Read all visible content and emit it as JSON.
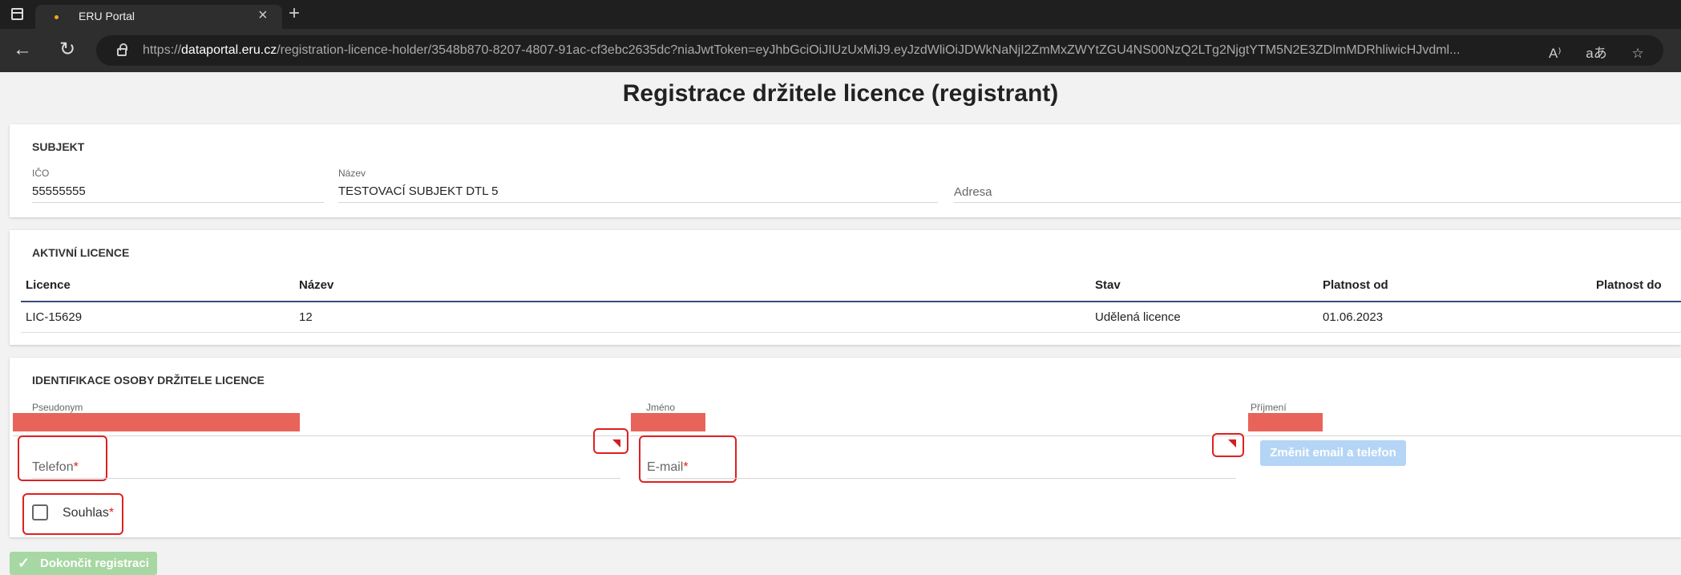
{
  "browser": {
    "tab_title": "ERU Portal",
    "tab_close": "×",
    "new_tab": "+",
    "url_scheme": "https://",
    "url_host": "dataportal.eru.cz",
    "url_path": "/registration-licence-holder/3548b870-8207-4807-91ac-cf3ebc2635dc?niaJwtToken=eyJhbGciOiJIUzUxMiJ9.eyJzdWliOiJDWkNaNjI2ZmMxZWYtZGU4NS00NzQ2LTg2NjgtYTM5N2E3ZDlmMDRhliwicHJvdml...",
    "icons": [
      "back-icon",
      "refresh-icon",
      "lock-icon",
      "read-aloud-icon",
      "translate-icon",
      "favorites-icon"
    ],
    "read_aloud_glyph": "A⁾",
    "translate_glyph": "aあ",
    "favorite_glyph": "☆"
  },
  "page": {
    "title": "Registrace držitele licence (registrant)"
  },
  "subject": {
    "heading": "SUBJEKT",
    "ico_label": "IČO",
    "ico_value": "55555555",
    "name_label": "Název",
    "name_value": "TESTOVACÍ SUBJEKT DTL 5",
    "address_label": "Adresa"
  },
  "licences": {
    "heading": "AKTIVNÍ LICENCE",
    "columns": [
      "Licence",
      "Název",
      "Stav",
      "Platnost od",
      "Platnost do"
    ],
    "rows": [
      {
        "licence": "LIC-15629",
        "name": "12",
        "status": "Udělená licence",
        "valid_from": "01.06.2023",
        "valid_to": ""
      }
    ]
  },
  "identification": {
    "heading": "IDENTIFIKACE OSOBY DRŽITELE LICENCE",
    "pseudonym_label": "Pseudonym",
    "first_name_label": "Jméno",
    "last_name_label": "Příjmení",
    "phone_label": "Telefon",
    "email_label": "E-mail",
    "required_mark": "*",
    "change_button": "Změnit email a telefon",
    "consent_label": "Souhlas",
    "colors": {
      "redaction": "#e8645a",
      "annotation": "#e02020"
    }
  },
  "footer": {
    "finish_button": "Dokončit registraci",
    "finish_icon": "check-icon"
  }
}
